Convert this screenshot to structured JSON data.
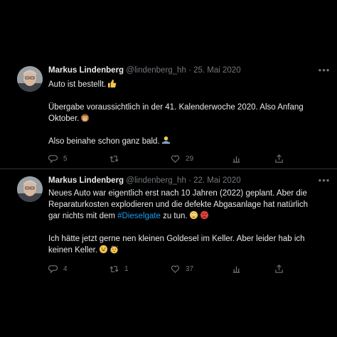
{
  "tweets": [
    {
      "author_name": "Markus Lindenberg",
      "handle": "@lindenberg_hh",
      "separator": "·",
      "date": "25. Mai 2020",
      "paragraphs": [
        "Auto ist bestellt.",
        "Übergabe voraussichtlich in der 41. Kalenderwoche 2020. Also Anfang Oktober.",
        "Also beinahe schon ganz bald."
      ],
      "replies": "5",
      "retweets": "",
      "likes": "29",
      "icons": [
        "reply-icon",
        "retweet-icon",
        "like-icon",
        "analytics-icon",
        "share-icon"
      ]
    },
    {
      "author_name": "Markus Lindenberg",
      "handle": "@lindenberg_hh",
      "separator": "·",
      "date": "22. Mai 2020",
      "paragraph1_before": "Neues Auto war eigentlich erst nach 10 Jahren (2022) geplant. Aber die Reparaturkosten explodieren und die defekte Abgasanlage hat natürlich gar nichts mit dem ",
      "hashtag": "#Dieselgate",
      "paragraph1_after": " zu tun.",
      "paragraph2": "Ich hätte jetzt gerne nen kleinen Goldesel im Keller. Aber leider hab ich keinen Keller.",
      "replies": "4",
      "retweets": "1",
      "likes": "37",
      "icons": [
        "reply-icon",
        "retweet-icon",
        "like-icon",
        "analytics-icon",
        "share-icon"
      ]
    }
  ],
  "colors": {
    "background": "#000000",
    "text": "#e7e9ea",
    "secondary": "#71767b",
    "link": "#1d9bf0",
    "divider": "#2f3336"
  }
}
